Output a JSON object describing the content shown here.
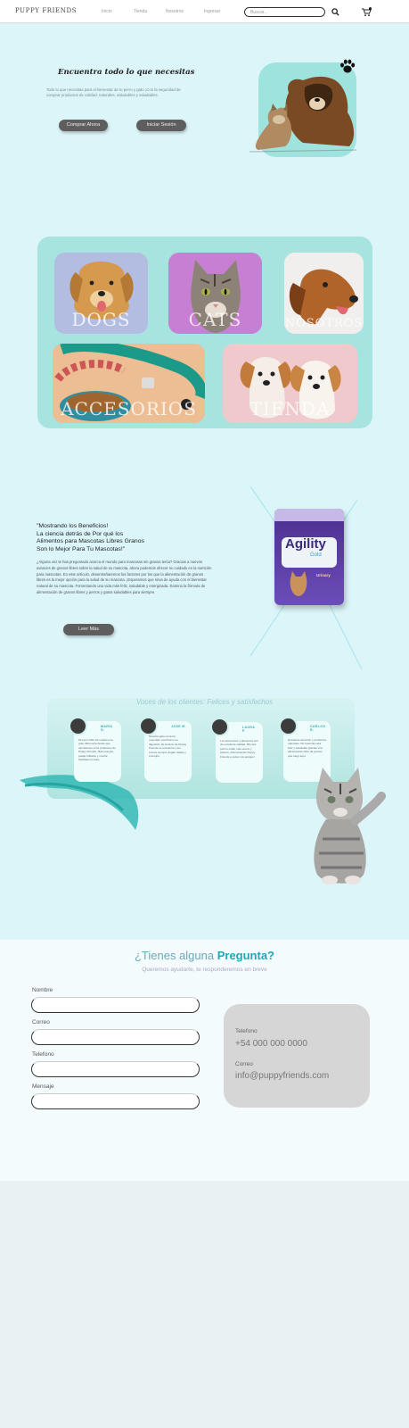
{
  "header": {
    "logo": "PUPPY FRIENDS",
    "nav": [
      "Inicio",
      "Tienda",
      "Nosotros",
      "Ingresar"
    ],
    "search_placeholder": "Buscar..."
  },
  "hero": {
    "title": "Encuentra todo lo que necesitas",
    "subtitle": "Todo lo que necesitas para el bienestar de tu perro y gato ¡Con la seguridad de comprar productos de calidad, naturales, saludables y saludables.",
    "buy_button": "Comprar Ahora",
    "login_button": "Iniciar Sesión"
  },
  "categories": [
    {
      "label": "DOGS"
    },
    {
      "label": "CATS"
    },
    {
      "label": "NOSOTROS"
    },
    {
      "label": "ACCESORIOS"
    },
    {
      "label": "TIENDA"
    }
  ],
  "benefits": {
    "heading_lines": [
      "\"Mostrando los Beneficios!",
      "La ciencia detrás de Por qué los",
      "Alimentos para Mascotas Libres Granos",
      "Son lo Mejor Para Tu Mascotas!\""
    ],
    "body": "¿Alguna vez te has preguntado acerca el mundo para mascotas sin granos tenía? Gracias a nuevos avances de granos libres sobre la salud de su mascota, ahora podemos ofrecer su cuidado en la nutrición para mascotas. En este artículo, desentrañaremos los factores por los que la alimentación de granos libres es la mejor opción para la salud de su mascota. ¡Esperamos que sirva de ayuda con el bienestar natural de su mascota. Fomentando una vida más feliz, saludable y energizada. Domina la fórmula de alimentación de granos libres y perros y gatos saludables para siempre.",
    "button": "Leer Más",
    "product_brand": "Agility",
    "product_sub": "Gold",
    "product_variant": "Urinary"
  },
  "testimonials": {
    "title": "Voces de los clientes: Felices y satisfechos",
    "items": [
      {
        "name": "MARIA G.",
        "text": "Mi perro Max ha notado una gran diferencia desde que cambiamos a los productos de Puppy Friends. Más energía, pelaje brillante y mucha felicidad en casa."
      },
      {
        "name": "JOSE M.",
        "text": "Nuestra gata Luna ha mejorado muchísimo su digestión. El servicio de Puppy Friends es excelente y los envíos siempre llegan rápido y a tiempo."
      },
      {
        "name": "LAURA P.",
        "text": "Los accesorios y alimentos son de excelente calidad. Mis dos perros están más sanos y activos. ¡Recomiendo Puppy Friends a todos mis amigos!"
      },
      {
        "name": "CARLOS R.",
        "text": "Excelente atención y productos naturales. Mi mascota está feliz y saludable gracias a la alimentación libre de granos que elegí aquí."
      }
    ]
  },
  "contact": {
    "title_plain": "¿Tienes alguna ",
    "title_highlight": "Pregunta?",
    "subtitle": "Queremos ayudarte, te responderemos en breve",
    "fields": [
      "Nombre",
      "Correo",
      "Telefono",
      "Mensaje"
    ],
    "phone_label": "Telefono",
    "phone_value": "+54 000 000 0000",
    "email_label": "Correo",
    "email_value": "info@puppyfriends.com"
  },
  "colors": {
    "accent": "#1fa6b8",
    "background": "#dcf5f9",
    "button": "#5e5e5e",
    "panel": "#a7e4e0"
  },
  "icons": {
    "search": "search-icon",
    "cart": "cart-icon",
    "paw": "paw-icon"
  }
}
